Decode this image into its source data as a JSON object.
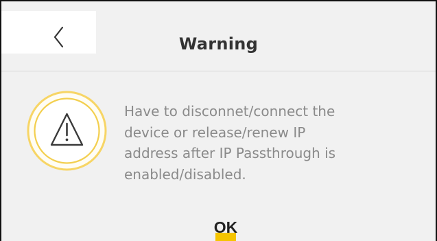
{
  "dialog": {
    "title": "Warning",
    "message": "Have to disconnet/connect the\ndevice or release/renew IP\naddress after IP Passthrough is\nenabled/disabled.",
    "ok_label": "OK"
  },
  "icons": {
    "back": "chevron-left-icon",
    "warning": "warning-triangle-icon"
  },
  "colors": {
    "accent": "#f5c400",
    "icon_ring": "#f7d565",
    "background": "#f1f1f1",
    "title": "#333333",
    "message": "#8a8a8a"
  }
}
